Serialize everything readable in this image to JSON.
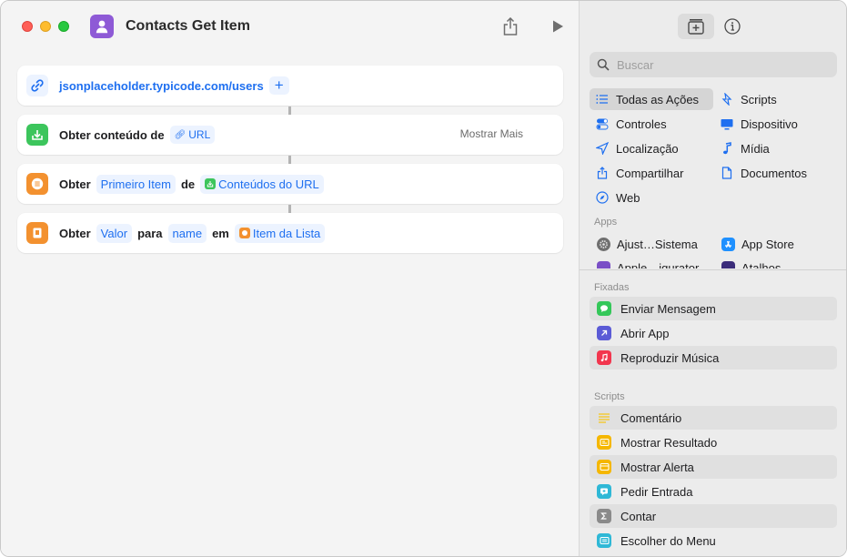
{
  "window": {
    "title": "Contacts Get Item"
  },
  "actions": {
    "url": {
      "value": "jsonplaceholder.typicode.com/users",
      "add_label": "+"
    },
    "get_contents": {
      "label": "Obter conteúdo de",
      "url_token": "URL",
      "show_more": "Mostrar Mais"
    },
    "get_item": {
      "label": "Obter",
      "item_token": "Primeiro Item",
      "from_label": "de",
      "source_token": "Conteúdos do URL"
    },
    "get_value": {
      "label": "Obter",
      "value_token": "Valor",
      "for_label": "para",
      "key_token": "name",
      "in_label": "em",
      "source_token": "Item da Lista"
    }
  },
  "sidebar": {
    "search_placeholder": "Buscar",
    "categories": [
      {
        "label": "Todas as Ações",
        "icon": "list-icon",
        "selected": true
      },
      {
        "label": "Scripts",
        "icon": "scripts-icon"
      },
      {
        "label": "Controles",
        "icon": "toggle-icon"
      },
      {
        "label": "Dispositivo",
        "icon": "display-icon"
      },
      {
        "label": "Localização",
        "icon": "location-icon"
      },
      {
        "label": "Mídia",
        "icon": "music-note-icon"
      },
      {
        "label": "Compartilhar",
        "icon": "share-icon"
      },
      {
        "label": "Documentos",
        "icon": "document-icon"
      },
      {
        "label": "Web",
        "icon": "compass-icon"
      }
    ],
    "apps_label": "Apps",
    "apps": [
      {
        "label": "Ajust…Sistema",
        "icon": "settings-icon"
      },
      {
        "label": "App Store",
        "icon": "app-store-icon"
      },
      {
        "label": "Apple…igurator",
        "icon": "configurator-icon"
      },
      {
        "label": "Atalhos",
        "icon": "shortcuts-icon"
      }
    ],
    "pinned_label": "Fixadas",
    "pinned": [
      {
        "label": "Enviar Mensagem",
        "icon": "message-icon",
        "color": "#34c759"
      },
      {
        "label": "Abrir App",
        "icon": "open-app-icon",
        "color": "#5b5bd6"
      },
      {
        "label": "Reproduzir Música",
        "icon": "music-icon",
        "color": "#f2364e"
      }
    ],
    "scripts_label": "Scripts",
    "scripts": [
      {
        "label": "Comentário",
        "icon": "comment-icon",
        "color": "#f5c518"
      },
      {
        "label": "Mostrar Resultado",
        "icon": "result-icon",
        "color": "#f5b700"
      },
      {
        "label": "Mostrar Alerta",
        "icon": "alert-icon",
        "color": "#f5b700"
      },
      {
        "label": "Pedir Entrada",
        "icon": "input-icon",
        "color": "#2fb8d6"
      },
      {
        "label": "Contar",
        "icon": "sigma-icon",
        "color": "#8a8a8a"
      },
      {
        "label": "Escolher do Menu",
        "icon": "menu-icon",
        "color": "#2fb8d6"
      }
    ]
  },
  "colors": {
    "accent": "#1e6ff0",
    "token_bg": "#ecf3ff",
    "app_icon": "#8e5ad6"
  }
}
